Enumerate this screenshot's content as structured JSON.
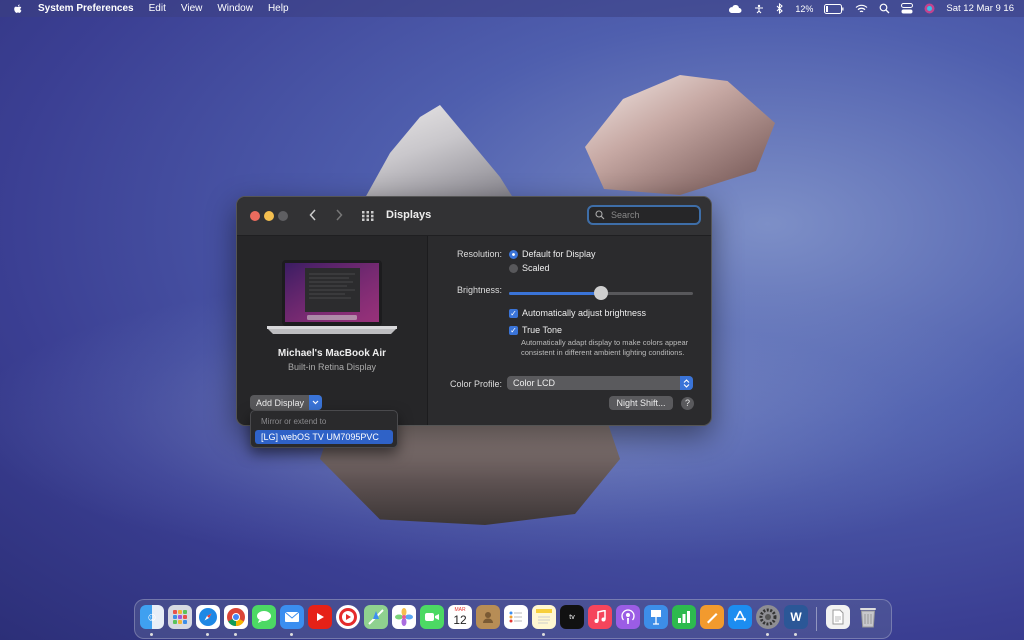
{
  "menubar": {
    "app_name": "System Preferences",
    "menus": [
      "Edit",
      "View",
      "Window",
      "Help"
    ],
    "battery": "12%",
    "datetime": "Sat 12 Mar  9 16"
  },
  "window": {
    "title": "Displays",
    "search_placeholder": "Search"
  },
  "device": {
    "name": "Michael's MacBook Air",
    "subtitle": "Built-in Retina Display"
  },
  "add_display": {
    "label": "Add Display",
    "popup_header": "Mirror or extend to",
    "popup_item": "[LG] webOS TV UM7095PVC"
  },
  "settings": {
    "resolution_label": "Resolution:",
    "resolution_options": [
      "Default for Display",
      "Scaled"
    ],
    "resolution_selected": "Default for Display",
    "brightness_label": "Brightness:",
    "brightness_level": 0.5,
    "auto_brightness_label": "Automatically adjust brightness",
    "auto_brightness_checked": true,
    "true_tone_label": "True Tone",
    "true_tone_checked": true,
    "true_tone_desc": "Automatically adapt display to make colors appear consistent in different ambient lighting conditions.",
    "color_profile_label": "Color Profile:",
    "color_profile_value": "Color LCD",
    "night_shift_label": "Night Shift...",
    "help_label": "?"
  },
  "dock": {
    "calendar_month": "MAR",
    "calendar_day": "12",
    "apps": [
      "finder-icon",
      "launchpad-icon",
      "safari-icon",
      "chrome-icon",
      "messages-icon",
      "mail-icon",
      "youtube-icon",
      "music-player-icon",
      "maps-icon",
      "photos-icon",
      "facetime-icon",
      "calendar-icon",
      "contacts-icon",
      "reminders-icon",
      "notes-icon",
      "apple-tv-icon",
      "music-icon",
      "podcasts-icon",
      "keynote-icon",
      "numbers-icon",
      "pages-icon",
      "app-store-icon",
      "system-preferences-icon",
      "word-icon",
      "document-icon",
      "trash-icon"
    ]
  }
}
